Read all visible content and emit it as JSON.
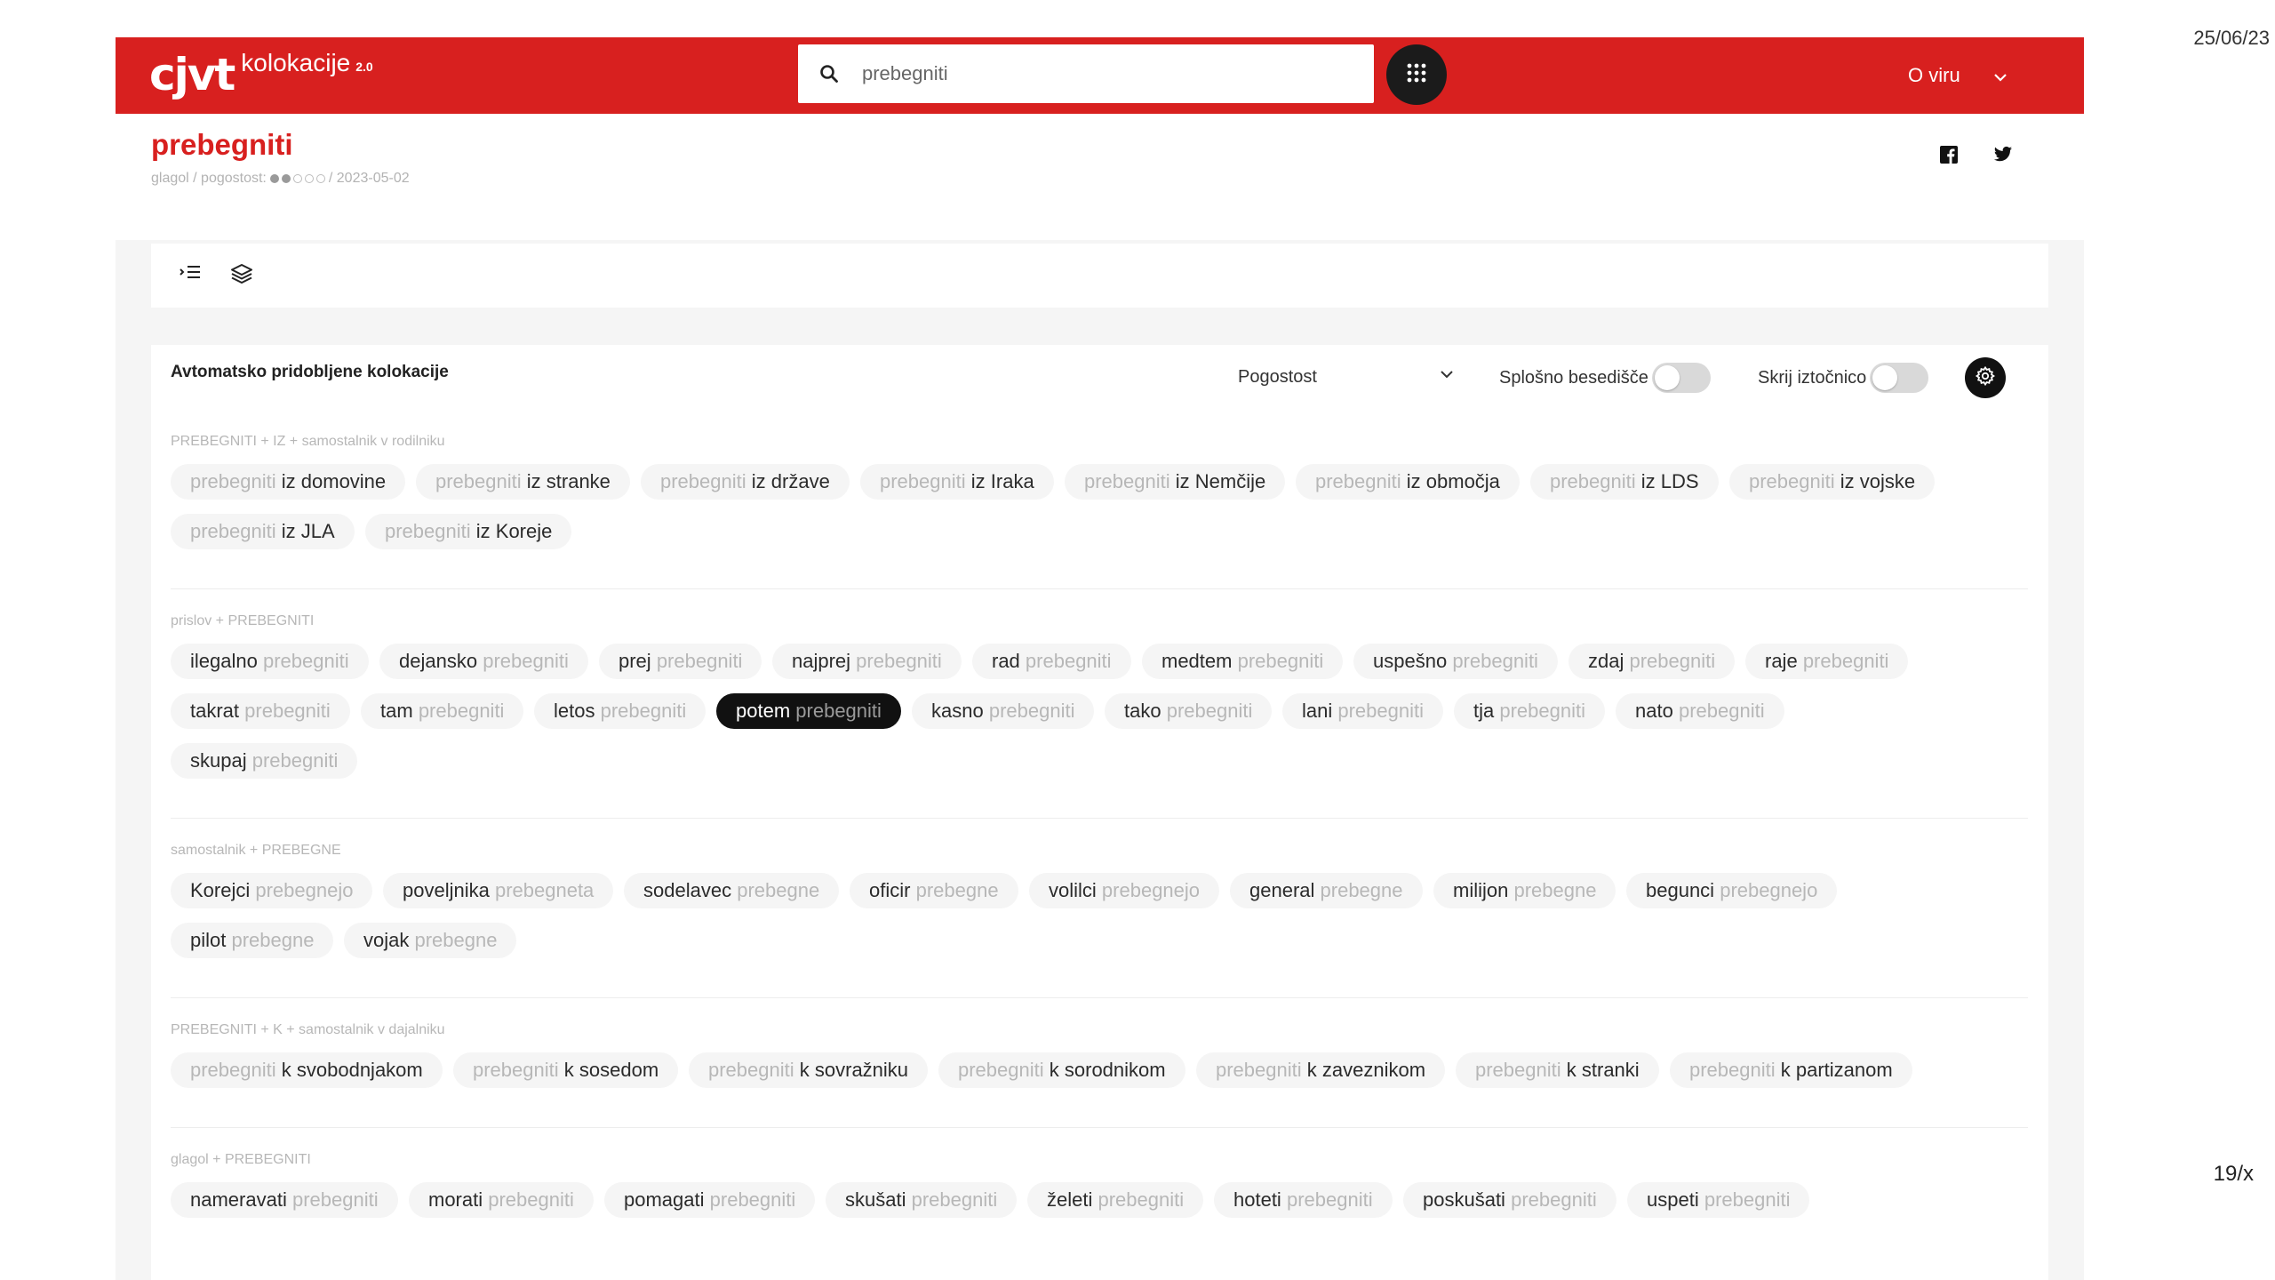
{
  "corner": {
    "date": "25/06/23",
    "page": "19/x"
  },
  "brand": {
    "mark": "cjvt",
    "name": "kolokacije",
    "version": "2.0"
  },
  "search": {
    "value": "prebegniti"
  },
  "nav": {
    "about": "O viru"
  },
  "entry": {
    "headword": "prebegniti",
    "pos": "glagol",
    "freq_label": "pogostost:",
    "freq_filled": 2,
    "freq_total": 5,
    "date": "2023-05-02"
  },
  "panel": {
    "title": "Avtomatsko pridobljene kolokacije",
    "sort_value": "Pogostost",
    "toggle_general": "Splošno besedišče",
    "toggle_hide": "Skrij iztočnico"
  },
  "sections": [
    {
      "label": "PREBEGNITI + IZ + samostalnik v rodilniku",
      "rows": [
        [
          {
            "head": "prebegniti",
            "coll": "iz domovine",
            "order": "hc"
          },
          {
            "head": "prebegniti",
            "coll": "iz stranke",
            "order": "hc"
          },
          {
            "head": "prebegniti",
            "coll": "iz države",
            "order": "hc"
          },
          {
            "head": "prebegniti",
            "coll": "iz Iraka",
            "order": "hc"
          },
          {
            "head": "prebegniti",
            "coll": "iz Nemčije",
            "order": "hc"
          },
          {
            "head": "prebegniti",
            "coll": "iz območja",
            "order": "hc"
          },
          {
            "head": "prebegniti",
            "coll": "iz LDS",
            "order": "hc"
          },
          {
            "head": "prebegniti",
            "coll": "iz vojske",
            "order": "hc"
          }
        ],
        [
          {
            "head": "prebegniti",
            "coll": "iz JLA",
            "order": "hc"
          },
          {
            "head": "prebegniti",
            "coll": "iz Koreje",
            "order": "hc"
          }
        ]
      ]
    },
    {
      "label": "prislov + PREBEGNITI",
      "rows": [
        [
          {
            "head": "prebegniti",
            "coll": "ilegalno",
            "order": "ch"
          },
          {
            "head": "prebegniti",
            "coll": "dejansko",
            "order": "ch"
          },
          {
            "head": "prebegniti",
            "coll": "prej",
            "order": "ch"
          },
          {
            "head": "prebegniti",
            "coll": "najprej",
            "order": "ch"
          },
          {
            "head": "prebegniti",
            "coll": "rad",
            "order": "ch"
          },
          {
            "head": "prebegniti",
            "coll": "medtem",
            "order": "ch"
          },
          {
            "head": "prebegniti",
            "coll": "uspešno",
            "order": "ch"
          },
          {
            "head": "prebegniti",
            "coll": "zdaj",
            "order": "ch"
          },
          {
            "head": "prebegniti",
            "coll": "raje",
            "order": "ch"
          }
        ],
        [
          {
            "head": "prebegniti",
            "coll": "takrat",
            "order": "ch"
          },
          {
            "head": "prebegniti",
            "coll": "tam",
            "order": "ch"
          },
          {
            "head": "prebegniti",
            "coll": "letos",
            "order": "ch"
          },
          {
            "head": "prebegniti",
            "coll": "potem",
            "order": "ch",
            "active": true
          },
          {
            "head": "prebegniti",
            "coll": "kasno",
            "order": "ch"
          },
          {
            "head": "prebegniti",
            "coll": "tako",
            "order": "ch"
          },
          {
            "head": "prebegniti",
            "coll": "lani",
            "order": "ch"
          },
          {
            "head": "prebegniti",
            "coll": "tja",
            "order": "ch"
          },
          {
            "head": "prebegniti",
            "coll": "nato",
            "order": "ch"
          }
        ],
        [
          {
            "head": "prebegniti",
            "coll": "skupaj",
            "order": "ch"
          }
        ]
      ]
    },
    {
      "label": "samostalnik + PREBEGNE",
      "rows": [
        [
          {
            "head": "prebegnejo",
            "coll": "Korejci",
            "order": "ch"
          },
          {
            "head": "prebegneta",
            "coll": "poveljnika",
            "order": "ch"
          },
          {
            "head": "prebegne",
            "coll": "sodelavec",
            "order": "ch"
          },
          {
            "head": "prebegne",
            "coll": "oficir",
            "order": "ch"
          },
          {
            "head": "prebegnejo",
            "coll": "volilci",
            "order": "ch"
          },
          {
            "head": "prebegne",
            "coll": "general",
            "order": "ch"
          },
          {
            "head": "prebegne",
            "coll": "milijon",
            "order": "ch"
          },
          {
            "head": "prebegnejo",
            "coll": "begunci",
            "order": "ch"
          }
        ],
        [
          {
            "head": "prebegne",
            "coll": "pilot",
            "order": "ch"
          },
          {
            "head": "prebegne",
            "coll": "vojak",
            "order": "ch"
          }
        ]
      ]
    },
    {
      "label": "PREBEGNITI + K + samostalnik v dajalniku",
      "rows": [
        [
          {
            "head": "prebegniti",
            "coll": "k svobodnjakom",
            "order": "hc"
          },
          {
            "head": "prebegniti",
            "coll": "k sosedom",
            "order": "hc"
          },
          {
            "head": "prebegniti",
            "coll": "k sovražniku",
            "order": "hc"
          },
          {
            "head": "prebegniti",
            "coll": "k sorodnikom",
            "order": "hc"
          },
          {
            "head": "prebegniti",
            "coll": "k zaveznikom",
            "order": "hc"
          },
          {
            "head": "prebegniti",
            "coll": "k stranki",
            "order": "hc"
          },
          {
            "head": "prebegniti",
            "coll": "k partizanom",
            "order": "hc"
          }
        ]
      ]
    },
    {
      "label": "glagol + PREBEGNITI",
      "rows": [
        [
          {
            "head": "prebegniti",
            "coll": "nameravati",
            "order": "ch"
          },
          {
            "head": "prebegniti",
            "coll": "morati",
            "order": "ch"
          },
          {
            "head": "prebegniti",
            "coll": "pomagati",
            "order": "ch"
          },
          {
            "head": "prebegniti",
            "coll": "skušati",
            "order": "ch"
          },
          {
            "head": "prebegniti",
            "coll": "želeti",
            "order": "ch"
          },
          {
            "head": "prebegniti",
            "coll": "hoteti",
            "order": "ch"
          },
          {
            "head": "prebegniti",
            "coll": "poskušati",
            "order": "ch"
          },
          {
            "head": "prebegniti",
            "coll": "uspeti",
            "order": "ch"
          }
        ]
      ]
    }
  ],
  "colors": {
    "brand_red": "#d8201f",
    "chip_bg": "#f5f5f5",
    "muted": "#b7b7b7"
  }
}
